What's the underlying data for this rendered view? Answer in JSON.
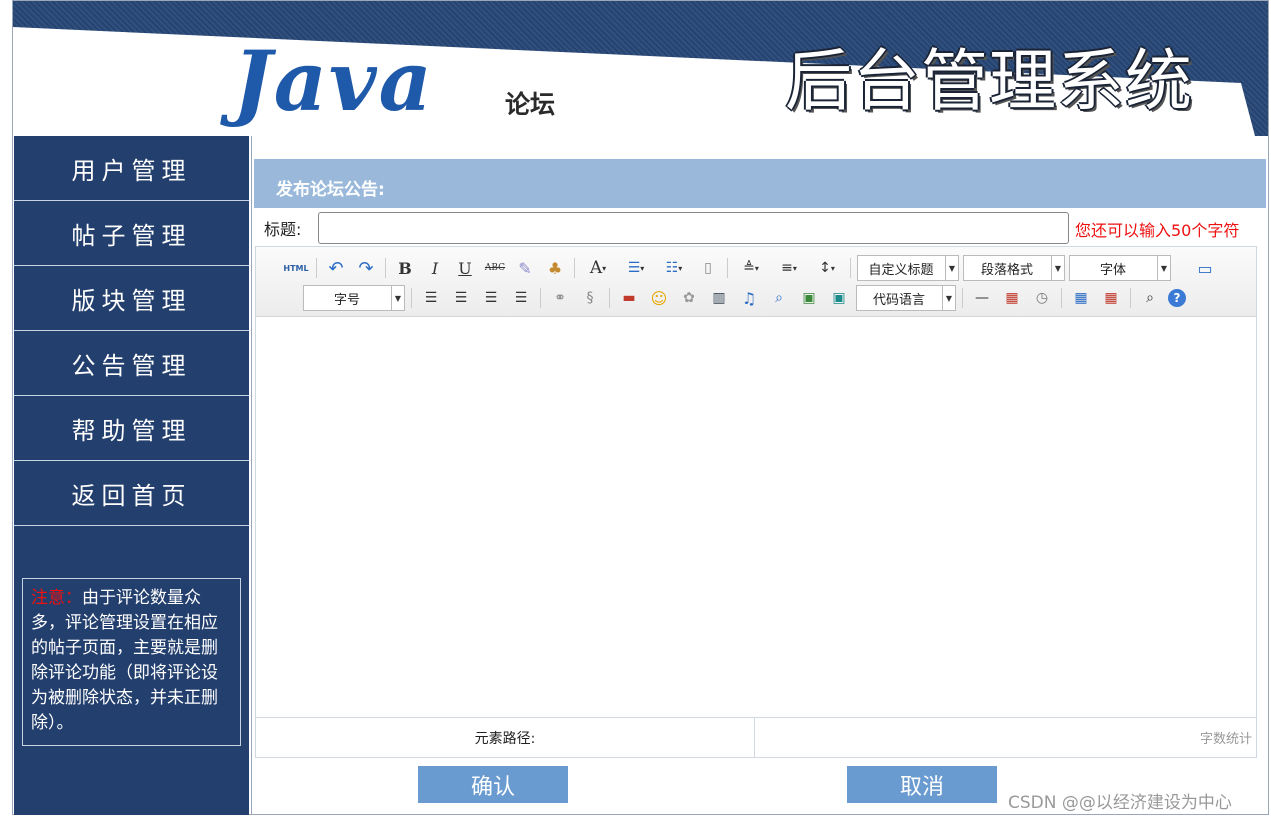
{
  "header": {
    "logo_text": "Java",
    "logo_sub": "论坛",
    "system_title": "后台管理系统"
  },
  "sidebar": {
    "items": [
      {
        "label": "用户管理"
      },
      {
        "label": "帖子管理"
      },
      {
        "label": "版块管理"
      },
      {
        "label": "公告管理"
      },
      {
        "label": "帮助管理"
      },
      {
        "label": "返回首页"
      }
    ],
    "notice_prefix": "注意：",
    "notice_text": "由于评论数量众多，评论管理设置在相应的帖子页面，主要就是删除评论功能（即将评论设为被删除状态，并未正删除）。"
  },
  "main": {
    "panel_title": "发布论坛公告:",
    "title_label": "标题:",
    "title_value": "",
    "char_tip": "您还可以输入50个字符"
  },
  "toolbar": {
    "html_label": "HTML",
    "custom_heading": "自定义标题",
    "paragraph_format": "段落格式",
    "font_family": "字体",
    "font_size": "字号",
    "code_language": "代码语言"
  },
  "status": {
    "element_path": "元素路径:",
    "word_count": "字数统计"
  },
  "buttons": {
    "confirm": "确认",
    "cancel": "取消"
  },
  "watermark": "CSDN @@以经济建设为中心"
}
